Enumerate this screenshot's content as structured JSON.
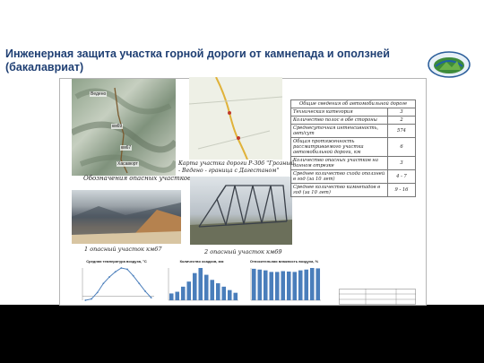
{
  "title": "Инженерная защита участка горной дороги от камнепада и оползней (бакалавриат)",
  "colors": {
    "title": "#1f3f73",
    "background": "#000000",
    "sheet": "#ffffff"
  },
  "map": {
    "labels": [
      "Ведено",
      "км69",
      "км67",
      "Хасавюрт"
    ],
    "caption": "Обозначения опасных участков"
  },
  "route_map": {
    "caption": "Карта участка дороги Р-306 \"Грозный - Ведено - граница с Дагестаном\""
  },
  "photo1": {
    "caption": "1 опасный участок км67"
  },
  "photo2": {
    "caption": "2 опасный участок км69"
  },
  "info_table": {
    "header": "Общие сведения об автомобильной дороге",
    "rows": [
      {
        "label": "Техническая категория",
        "value": "3"
      },
      {
        "label": "Количество полос в обе стороны",
        "value": "2"
      },
      {
        "label": "Среднесуточная интенсивность, авт/сут",
        "value": "574"
      },
      {
        "label": "Общая протяженность рассматриваемого участка автомобильной дороги, км",
        "value": "6"
      },
      {
        "label": "Количество опасных участков на данном отрезке",
        "value": "3"
      },
      {
        "label": "Среднее количество схода оползней в год (за 10 лет)",
        "value": "4 - 7"
      },
      {
        "label": "Среднее количество камнепадов в год (за 10 лет)",
        "value": "9 - 16"
      }
    ]
  },
  "charts_titles": [
    "Средняя температура воздуха, °С",
    "Количество осадков, мм",
    "Относительная влажность воздуха, %"
  ],
  "chart_data": [
    {
      "type": "line",
      "title": "Средняя температура воздуха, °С",
      "categories": [
        "1",
        "2",
        "3",
        "4",
        "5",
        "6",
        "7",
        "8",
        "9",
        "10",
        "11",
        "12"
      ],
      "series": [
        {
          "values": [
            -3,
            -2,
            3,
            10,
            15,
            19,
            22,
            21,
            16,
            10,
            4,
            -1
          ]
        }
      ]
    },
    {
      "type": "bar",
      "title": "Количество осадков, мм",
      "categories": [
        "1",
        "2",
        "3",
        "4",
        "5",
        "6",
        "7",
        "8",
        "9",
        "10",
        "11",
        "12"
      ],
      "series": [
        {
          "values": [
            20,
            25,
            40,
            55,
            80,
            95,
            75,
            60,
            50,
            40,
            30,
            22
          ]
        }
      ]
    },
    {
      "type": "bar",
      "title": "Относительная влажность воздуха, %",
      "categories": [
        "1",
        "2",
        "3",
        "4",
        "5",
        "6",
        "7",
        "8",
        "9",
        "10",
        "11",
        "12"
      ],
      "series": [
        {
          "values": [
            80,
            78,
            76,
            72,
            72,
            74,
            73,
            72,
            76,
            78,
            82,
            81
          ]
        }
      ]
    }
  ]
}
